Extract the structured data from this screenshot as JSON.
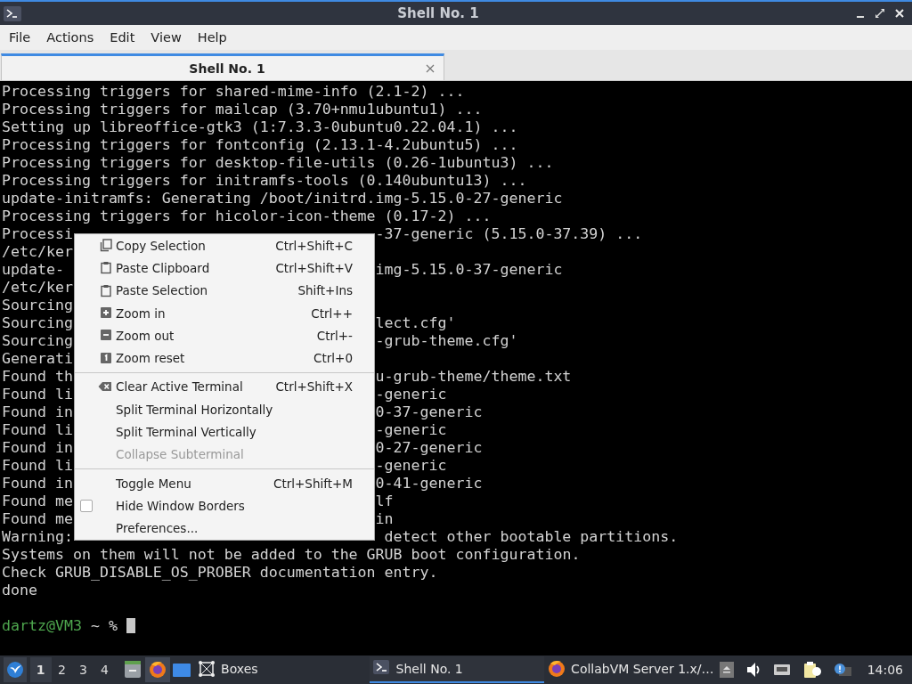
{
  "window": {
    "title": "Shell No. 1"
  },
  "menubar": [
    "File",
    "Actions",
    "Edit",
    "View",
    "Help"
  ],
  "tabs": [
    {
      "label": "Shell No. 1",
      "selected": true
    }
  ],
  "terminal": {
    "lines": [
      {
        "text": "Processing triggers for shared-mime-info (2.1-2) ..."
      },
      {
        "text": "Processing triggers for mailcap (3.70+nmu1ubuntu1) ..."
      },
      {
        "text": "Setting up libreoffice-gtk3 (1:7.3.3-0ubuntu0.22.04.1) ..."
      },
      {
        "text": "Processing triggers for fontconfig (2.13.1-4.2ubuntu5) ..."
      },
      {
        "text": "Processing triggers for desktop-file-utils (0.26-1ubuntu3) ..."
      },
      {
        "text": "Processing triggers for initramfs-tools (0.140ubuntu13) ..."
      },
      {
        "text": "update-initramfs: Generating /boot/initrd.img-5.15.0-27-generic"
      },
      {
        "text": "Processing triggers for hicolor-icon-theme (0.17-2) ..."
      },
      {
        "left": "Processi",
        "right": "-37-generic (5.15.0-37.39) ..."
      },
      {
        "left": "/etc/ker"
      },
      {
        "left": "update-",
        "right": "img-5.15.0-37-generic"
      },
      {
        "left": "/etc/ker"
      },
      {
        "left": "Sourcing"
      },
      {
        "left": "Sourcing",
        "right": "lect.cfg'"
      },
      {
        "left": "Sourcing",
        "right": "-grub-theme.cfg'"
      },
      {
        "left": "Generati"
      },
      {
        "left": "Found th",
        "right": "u-grub-theme/theme.txt"
      },
      {
        "left": "Found li",
        "right": "-generic"
      },
      {
        "left": "Found in",
        "right": "0-37-generic"
      },
      {
        "left": "Found li",
        "right": "-generic"
      },
      {
        "left": "Found in",
        "right": "0-27-generic"
      },
      {
        "left": "Found li",
        "right": "-generic"
      },
      {
        "left": "Found in",
        "right": "0-41-generic"
      },
      {
        "left": "Found me",
        "right": "lf"
      },
      {
        "left": "Found me",
        "right": "in"
      },
      {
        "left": "Warning:",
        "right": " detect other bootable partitions."
      },
      {
        "text": "Systems on them will not be added to the GRUB boot configuration."
      },
      {
        "text": "Check GRUB_DISABLE_OS_PROBER documentation entry."
      },
      {
        "text": "done"
      }
    ],
    "prompt": {
      "user_host": "dartz@VM3",
      "path": "~ %"
    }
  },
  "context_menu": {
    "items": [
      {
        "kind": "item",
        "label": "Copy Selection",
        "shortcut": "Ctrl+Shift+C",
        "disabled": false
      },
      {
        "kind": "item",
        "label": "Paste Clipboard",
        "shortcut": "Ctrl+Shift+V",
        "disabled": false
      },
      {
        "kind": "item",
        "label": "Paste Selection",
        "shortcut": "Shift+Ins",
        "disabled": false
      },
      {
        "kind": "item",
        "label": "Zoom in",
        "shortcut": "Ctrl++",
        "disabled": false
      },
      {
        "kind": "item",
        "label": "Zoom out",
        "shortcut": "Ctrl+-",
        "disabled": false
      },
      {
        "kind": "item",
        "label": "Zoom reset",
        "shortcut": "Ctrl+0",
        "disabled": false
      },
      {
        "kind": "separator"
      },
      {
        "kind": "item",
        "label": "Clear Active Terminal",
        "shortcut": "Ctrl+Shift+X",
        "disabled": false
      },
      {
        "kind": "item",
        "label": "Split Terminal Horizontally",
        "disabled": false
      },
      {
        "kind": "item",
        "label": "Split Terminal Vertically",
        "disabled": false
      },
      {
        "kind": "item",
        "label": "Collapse Subterminal",
        "disabled": true
      },
      {
        "kind": "separator"
      },
      {
        "kind": "item",
        "label": "Toggle Menu",
        "shortcut": "Ctrl+Shift+M",
        "disabled": false
      },
      {
        "kind": "check",
        "label": "Hide Window Borders",
        "checked": false
      },
      {
        "kind": "item",
        "label": "Preferences...",
        "disabled": false
      }
    ]
  },
  "taskbar": {
    "workspaces": [
      {
        "label": "1",
        "selected": true
      },
      {
        "label": "2",
        "selected": false
      },
      {
        "label": "3",
        "selected": false
      },
      {
        "label": "4",
        "selected": false
      }
    ],
    "tasks": [
      {
        "label": "Boxes",
        "selected": false
      },
      {
        "label": "Shell No. 1",
        "selected": true
      },
      {
        "label": "CollabVM Server 1.x/…",
        "selected": false
      }
    ],
    "clock": "14:06"
  }
}
